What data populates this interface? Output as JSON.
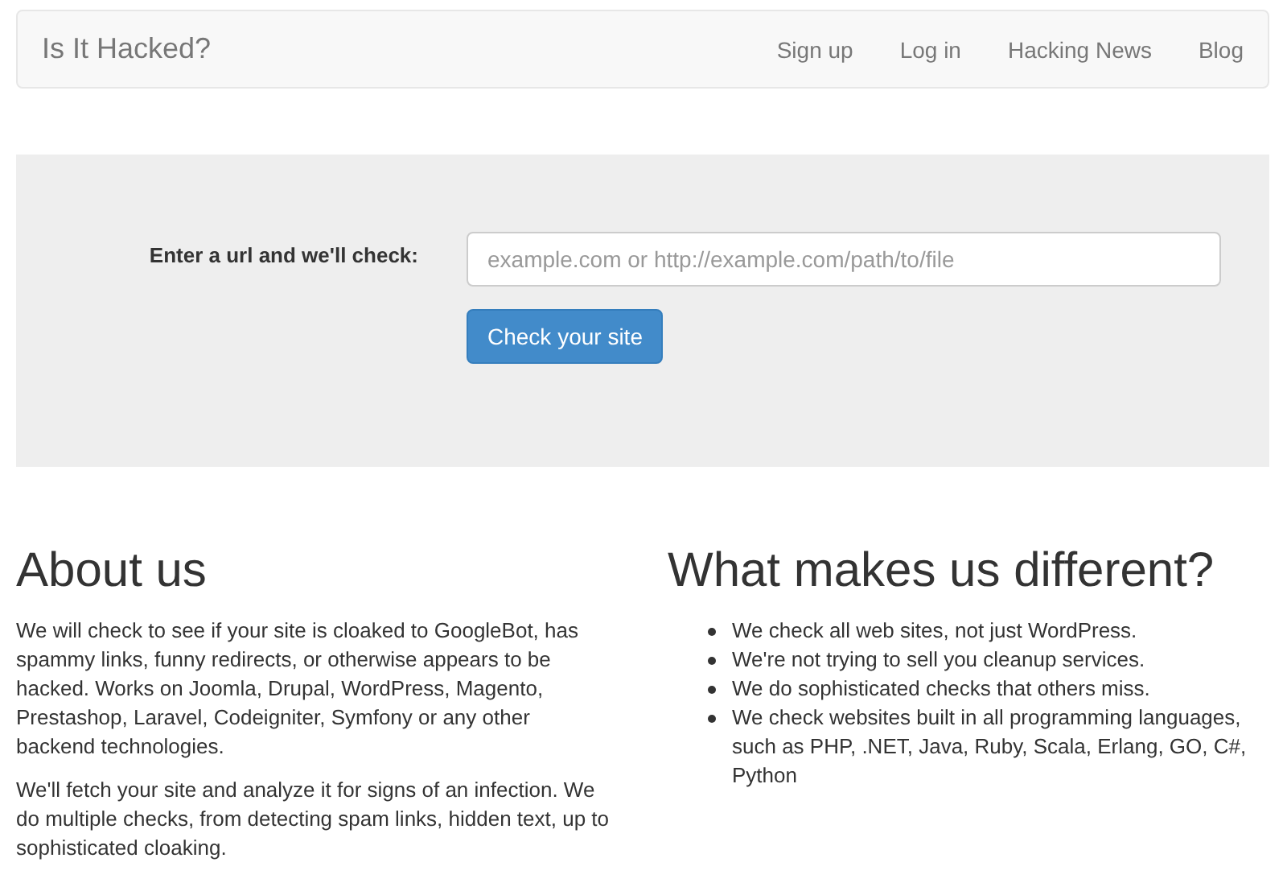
{
  "navbar": {
    "brand": "Is It Hacked?",
    "links": [
      "Sign up",
      "Log in",
      "Hacking News",
      "Blog"
    ]
  },
  "check_form": {
    "label": "Enter a url and we'll check:",
    "placeholder": "example.com or http://example.com/path/to/file",
    "button": "Check your site"
  },
  "about": {
    "heading": "About us",
    "paragraphs": [
      "We will check to see if your site is cloaked to GoogleBot, has spammy links, funny redirects, or otherwise appears to be hacked. Works on Joomla, Drupal, WordPress, Magento, Prestashop, Laravel, Codeigniter, Symfony or any other backend technologies.",
      "We'll fetch your site and analyze it for signs of an infection. We do multiple checks, from detecting spam links, hidden text, up to sophisticated cloaking."
    ]
  },
  "different": {
    "heading": "What makes us different?",
    "items": [
      "We check all web sites, not just WordPress.",
      "We're not trying to sell you cleanup services.",
      "We do sophisticated checks that others miss.",
      "We check websites built in all programming languages, such as PHP, .NET, Java, Ruby, Scala, Erlang, GO, C#, Python"
    ]
  }
}
